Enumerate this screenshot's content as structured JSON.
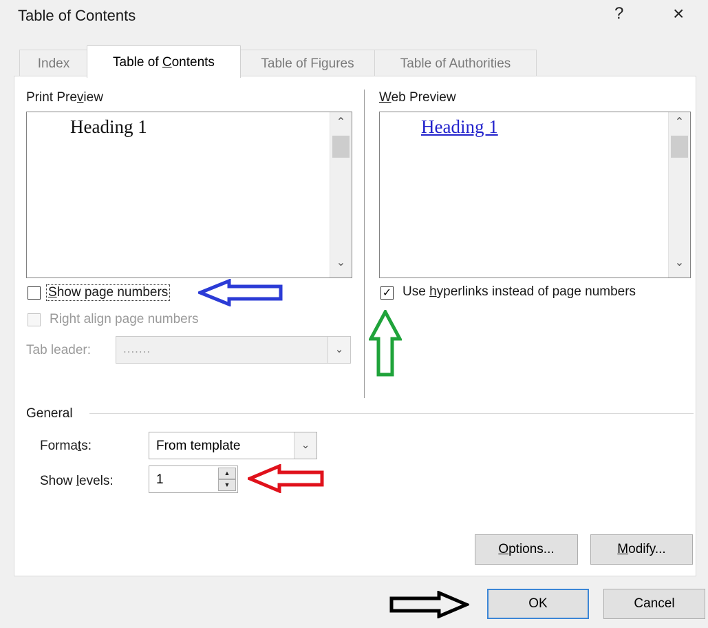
{
  "window": {
    "title": "Table of Contents",
    "help_glyph": "?",
    "close_glyph": "×"
  },
  "tabs": [
    {
      "label": "Index",
      "active": false
    },
    {
      "label": "Table of Contents",
      "active": true
    },
    {
      "label": "Table of Figures",
      "active": false
    },
    {
      "label": "Table of Authorities",
      "active": false
    }
  ],
  "print_preview": {
    "label": "Print Preview",
    "heading": "Heading 1",
    "show_page_numbers": {
      "label": "Show page numbers",
      "checked": false
    },
    "right_align": {
      "label": "Right align page numbers",
      "checked": false,
      "enabled": false
    },
    "tab_leader": {
      "label": "Tab leader:",
      "value": ".......",
      "enabled": false
    }
  },
  "web_preview": {
    "label": "Web Preview",
    "heading": "Heading 1",
    "use_hyperlinks": {
      "label": "Use hyperlinks instead of page numbers",
      "checked": true
    }
  },
  "general": {
    "label": "General",
    "formats": {
      "label": "Formats:",
      "value": "From template"
    },
    "show_levels": {
      "label": "Show levels:",
      "value": "1"
    }
  },
  "buttons": {
    "options": "Options...",
    "modify": "Modify...",
    "ok": "OK",
    "cancel": "Cancel"
  },
  "icons": {
    "scroll_up": "⌃",
    "scroll_down": "⌄",
    "dropdown": "⌄",
    "check": "✓",
    "spin_up": "▲",
    "spin_down": "▼"
  },
  "colors": {
    "annotation_blue": "#2b3bd6",
    "annotation_green": "#1fa33a",
    "annotation_red": "#e0111b",
    "annotation_black": "#000000",
    "hyperlink": "#2222cc",
    "ok_border": "#3b86d6"
  }
}
